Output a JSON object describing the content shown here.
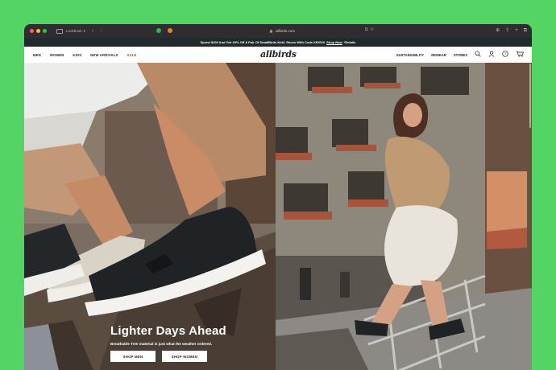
{
  "browser": {
    "traffic_lights": [
      "#ff5f57",
      "#febc2e",
      "#28c840"
    ],
    "profile_label": "Lookbook",
    "address": "allbirds.com",
    "extension_colors": [
      "#2fb45a",
      "#e0882e"
    ],
    "icons": [
      "sidebar-icon",
      "back-icon",
      "forward-icon",
      "lock-icon",
      "translate-icon",
      "reload-icon",
      "download-icon",
      "share-icon",
      "new-tab-icon",
      "tabs-icon"
    ]
  },
  "promo": {
    "text": "Spend $100 And Get 20% Off A Pair Of SmallBirds Kids' Shoes With Code KIDS20",
    "link_label": "Shop Now",
    "suffix": "*Details"
  },
  "sitenav": {
    "left": [
      {
        "label": "MEN"
      },
      {
        "label": "WOMEN"
      },
      {
        "label": "KIDS"
      },
      {
        "label": "NEW ARRIVALS"
      },
      {
        "label": "SALE"
      }
    ],
    "logo": "allbirds",
    "right": [
      {
        "label": "SUSTAINABILITY"
      },
      {
        "label": "REWEAR"
      },
      {
        "label": "STORES"
      }
    ],
    "icons": [
      "search-icon",
      "account-icon",
      "help-icon",
      "cart-icon"
    ],
    "sale_color": "#c0341d"
  },
  "hero": {
    "title": "Lighter Days Ahead",
    "subtitle": "Breathable Tree material is just what the weather ordered.",
    "buttons": [
      {
        "label": "SHOP MEN"
      },
      {
        "label": "SHOP WOMEN"
      }
    ]
  }
}
